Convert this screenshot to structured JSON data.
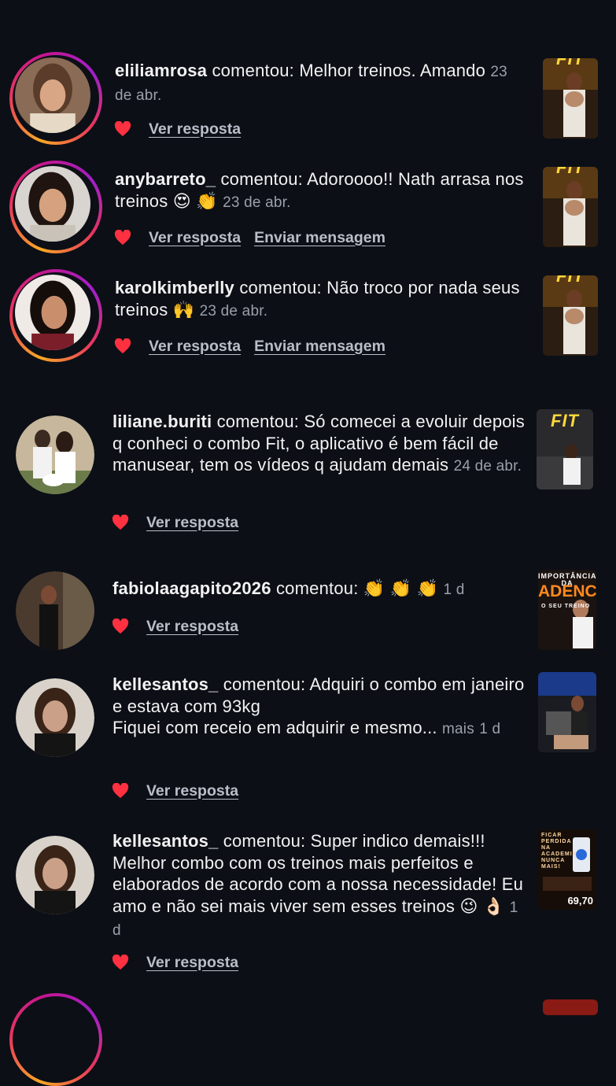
{
  "comments": [
    {
      "username": "eliliamrosa",
      "verb": "comentou:",
      "text": "Melhor treinos. Amando",
      "time": "23 de abr.",
      "more": "",
      "actions": [
        "Ver resposta"
      ]
    },
    {
      "username": "anybarreto_",
      "verb": "comentou:",
      "text": "Adoroooo!! Nath arrasa nos treinos 😍 👏",
      "time": "23 de abr.",
      "more": "",
      "actions": [
        "Ver resposta",
        "Enviar mensagem"
      ]
    },
    {
      "username": "karolkimberlly",
      "verb": "comentou:",
      "text": "Não troco por nada seus treinos 🙌",
      "time": "23 de abr.",
      "more": "",
      "actions": [
        "Ver resposta",
        "Enviar mensagem"
      ]
    },
    {
      "username": "liliane.buriti",
      "verb": "comentou:",
      "text": "Só comecei a evoluir depois q conheci o combo Fit, o aplicativo é bem fácil de manusear, tem os vídeos q ajudam demais",
      "time": "24 de abr.",
      "more": "",
      "actions": [
        "Ver resposta"
      ]
    },
    {
      "username": "fabiolaagapito2026",
      "verb": "comentou:",
      "text": "👏 👏 👏",
      "time": "1 d",
      "more": "",
      "actions": [
        "Ver resposta"
      ]
    },
    {
      "username": "kellesantos_",
      "verb": "comentou:",
      "text": "Adquiri o combo em janeiro e estava com 93kg",
      "text2": "Fiquei com receio em adquirir e mesmo...",
      "time": "1 d",
      "more": "mais",
      "actions": [
        "Ver resposta"
      ]
    },
    {
      "username": "kellesantos_",
      "verb": "comentou:",
      "text": "Super indico demais!!! Melhor combo com os treinos mais perfeitos e elaborados de acordo com a nossa necessidade! Eu amo e não sei mais viver sem esses treinos 😉 👌🏻",
      "time": "1 d",
      "more": "",
      "actions": [
        "Ver resposta"
      ]
    }
  ],
  "thumbnails": {
    "fit_label": "FIT",
    "cadencia_top": "IMPORTÂNCIA DA",
    "cadencia_main": "ADENCIA",
    "cadencia_sub": "O SEU TREINO",
    "academia_text": "FICAR PERDIDA NA ACADEMIA NUNCA MAIS!",
    "academia_price": "69,70"
  },
  "colors": {
    "background": "#0c0f16",
    "heart": "#ff3040",
    "link": "#b9bec8",
    "time": "#9aa0aa"
  }
}
